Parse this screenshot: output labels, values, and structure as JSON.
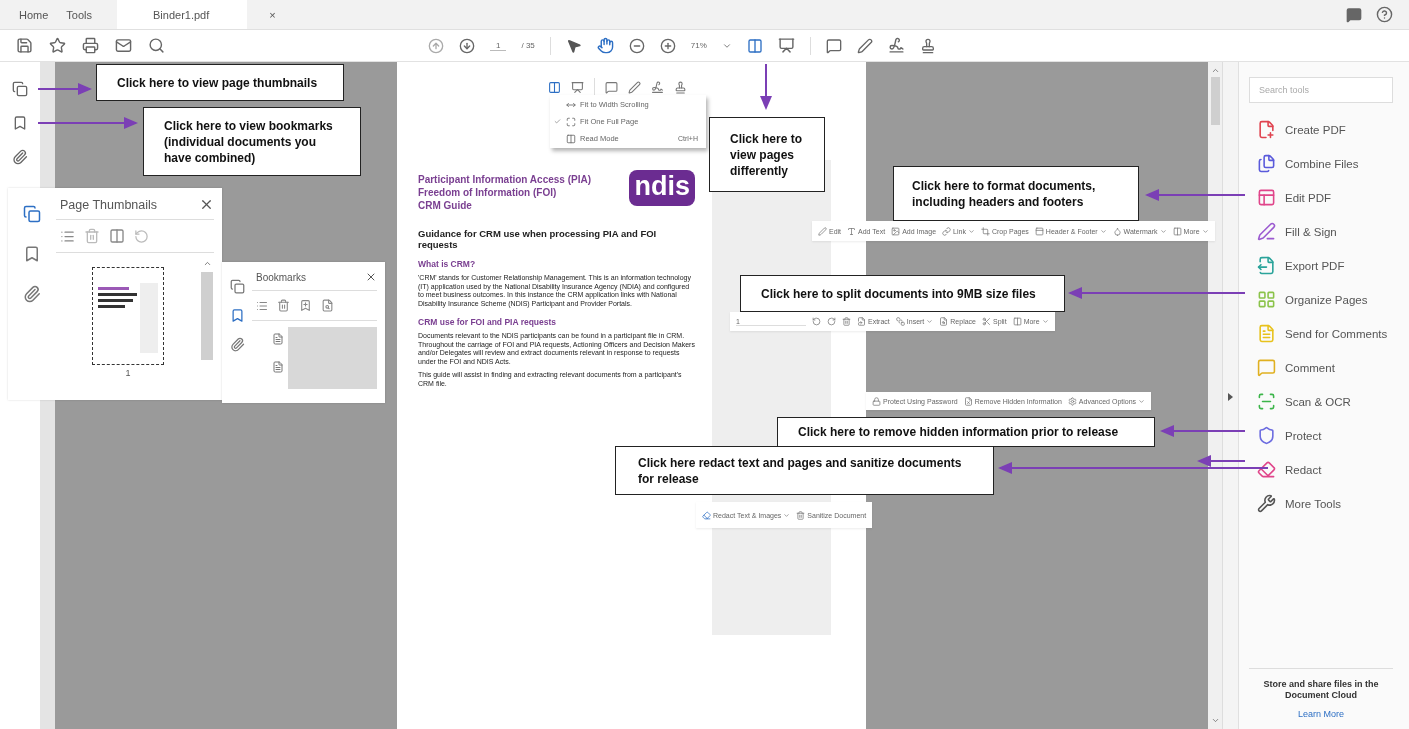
{
  "tabs": [
    {
      "label": "Home",
      "selected": false
    },
    {
      "label": "Tools",
      "selected": false
    },
    {
      "label": "Binder1.pdf",
      "selected": true,
      "close": "×"
    }
  ],
  "toolbar": {
    "page_number": "1",
    "page_count": "/ 35",
    "zoom": "71%",
    "tools": [
      {
        "selected": false
      },
      {
        "selected": true
      }
    ]
  },
  "thumbnails_panel": {
    "title": "Page Thumbnails",
    "rail": [
      {
        "selected": true
      },
      {
        "selected": false
      },
      {
        "selected": false
      }
    ],
    "page_label": "1"
  },
  "bookmarks_panel": {
    "title": "Bookmarks",
    "rail": [
      {
        "selected": false
      },
      {
        "selected": true
      },
      {
        "selected": false
      }
    ]
  },
  "view_menu": [
    {
      "label": "Fit to Width Scrolling",
      "checked": false
    },
    {
      "label": "Fit One Full Page",
      "checked": true
    },
    {
      "label": "Read Mode",
      "checked": false,
      "shortcut": "Ctrl+H"
    }
  ],
  "document": {
    "titles": [
      "Participant Information Access (PIA)",
      "Freedom of Information (FOI)",
      "CRM Guide"
    ],
    "logo": "ndis",
    "sections": [
      {
        "kind": "heading",
        "text": "Guidance for CRM use when processing PIA and FOI requests"
      },
      {
        "kind": "subheading",
        "text": "What is CRM?"
      },
      {
        "kind": "paragraph",
        "text": "'CRM' stands for Customer Relationship Management. This is an information technology (IT) application used by the National Disability Insurance Agency (NDIA) and configured to meet business outcomes. In this instance the CRM application links with National Disability Insurance Scheme (NDIS) Participant and Provider Portals."
      },
      {
        "kind": "subheading",
        "text": "CRM use for FOI and PIA requests"
      },
      {
        "kind": "paragraph",
        "text": "Documents relevant to the NDIS participants can be found in a participant file in CRM. Throughout the carriage of FOI and PIA requests, Actioning Officers and Decision Makers and/or Delegates will review and extract documents relevant in response to requests under the FOI and NDIS Acts."
      },
      {
        "kind": "paragraph",
        "text": "This guide will assist in finding and extracting relevant documents from a participant's CRM file."
      }
    ]
  },
  "edit_toolbar": [
    {
      "label": "Edit",
      "dropdown": false
    },
    {
      "label": "Add Text",
      "dropdown": false
    },
    {
      "label": "Add Image",
      "dropdown": false
    },
    {
      "label": "Link",
      "dropdown": true
    },
    {
      "label": "Crop Pages",
      "dropdown": false
    },
    {
      "label": "Header & Footer",
      "dropdown": true
    },
    {
      "label": "Watermark",
      "dropdown": true
    },
    {
      "label": "More",
      "dropdown": true
    }
  ],
  "organize_toolbar": {
    "page_field": "1",
    "items": [
      {
        "label": "Extract",
        "dropdown": false
      },
      {
        "label": "Insert",
        "dropdown": true
      },
      {
        "label": "Replace",
        "dropdown": false
      },
      {
        "label": "Split",
        "dropdown": false
      },
      {
        "label": "More",
        "dropdown": true
      }
    ]
  },
  "protect_toolbar": [
    {
      "label": "Protect Using Password",
      "dropdown": false
    },
    {
      "label": "Remove Hidden Information",
      "dropdown": false
    },
    {
      "label": "Advanced Options",
      "dropdown": true
    }
  ],
  "redact_toolbar": [
    {
      "label": "Redact Text & Images",
      "dropdown": true
    },
    {
      "label": "Sanitize Document",
      "dropdown": false
    }
  ],
  "callouts": [
    "Click here to view page thumbnails",
    "Click here to view bookmarks (individual documents you have combined)",
    "Click here to view pages differently",
    "Click here to format documents, including headers and footers",
    "Click here to split documents into 9MB size files",
    "Click here to remove hidden information prior to release",
    "Click here redact text and pages and sanitize documents for release"
  ],
  "tools_panel": {
    "search_placeholder": "Search tools",
    "items": [
      {
        "label": "Create PDF",
        "color": "#e0434f"
      },
      {
        "label": "Combine Files",
        "color": "#5a5adb"
      },
      {
        "label": "Edit PDF",
        "color": "#e0458a"
      },
      {
        "label": "Fill & Sign",
        "color": "#9b59d0"
      },
      {
        "label": "Export PDF",
        "color": "#2aa39a"
      },
      {
        "label": "Organize Pages",
        "color": "#8bc34a"
      },
      {
        "label": "Send for Comments",
        "color": "#e8c21c"
      },
      {
        "label": "Comment",
        "color": "#e0b020"
      },
      {
        "label": "Scan & OCR",
        "color": "#3cb54a"
      },
      {
        "label": "Protect",
        "color": "#6c6ce0"
      },
      {
        "label": "Redact",
        "color": "#e0458a"
      },
      {
        "label": "More Tools",
        "color": "#555555"
      }
    ],
    "cloud_text": "Store and share files in the Document Cloud",
    "link": "Learn More"
  }
}
